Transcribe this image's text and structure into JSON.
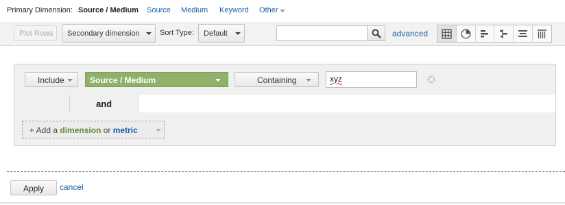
{
  "primary_dimension": {
    "label": "Primary Dimension:",
    "current": "Source / Medium",
    "options": [
      "Source",
      "Medium",
      "Keyword",
      "Other"
    ]
  },
  "toolbar": {
    "plot_rows_label": "Plot Rows",
    "secondary_dimension_label": "Secondary dimension",
    "sort_type_label": "Sort Type:",
    "sort_type_value": "Default",
    "search_value": "",
    "advanced_label": "advanced",
    "view_icons": [
      "table-view-icon",
      "pie-view-icon",
      "bar-view-icon",
      "comparison-view-icon",
      "term-cloud-view-icon",
      "pivot-view-icon"
    ],
    "active_view": "table-view-icon"
  },
  "filter": {
    "include_label": "Include",
    "dimension_label": "Source / Medium",
    "match_label": "Containing",
    "value": "xyz",
    "and_label": "and",
    "add_prefix": "+ Add a",
    "add_dimension_word": "dimension",
    "add_or_word": "or",
    "add_metric_word": "metric"
  },
  "actions": {
    "apply_label": "Apply",
    "cancel_label": "cancel"
  },
  "colors": {
    "link": "#1a5ea8",
    "dimension_green": "#8fb16a",
    "dimension_word": "#5b8a37"
  }
}
